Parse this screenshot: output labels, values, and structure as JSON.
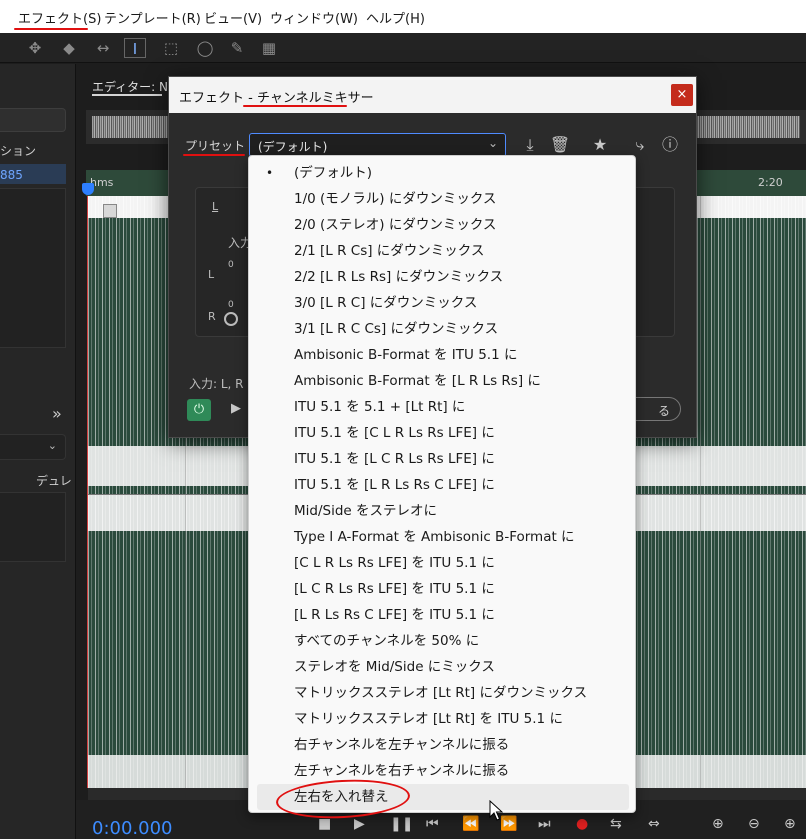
{
  "menubar": {
    "items": [
      "エフェクト(S)",
      "テンプレート(R)",
      "ビュー(V)",
      "ウィンドウ(W)",
      "ヘルプ(H)"
    ]
  },
  "left_panel": {
    "label_session": "ション",
    "value_selected": "885",
    "label_duration": "デュレ"
  },
  "editor": {
    "tab_label": "エディター: NSC",
    "ruler_ticks": [
      "hms",
      "2:20"
    ],
    "timecode": "0:00.000"
  },
  "dialog": {
    "title": "エフェクト - チャンネルミキサー",
    "close_label": "×",
    "preset_label": "プリセット :",
    "preset_value": "(デフォルト)",
    "inner_L": "L",
    "inner_input": "入力",
    "row_L": "L",
    "row_R": "R",
    "zero1": "0",
    "zero2": "0",
    "input_footer": "入力: L, R",
    "ok_partial": "る"
  },
  "dropdown": {
    "items": [
      "(デフォルト)",
      "1/0 (モノラル) にダウンミックス",
      "2/0 (ステレオ) にダウンミックス",
      "2/1 [L R Cs] にダウンミックス",
      "2/2 [L R Ls Rs] にダウンミックス",
      "3/0 [L R C] にダウンミックス",
      "3/1 [L R C Cs] にダウンミックス",
      "Ambisonic B-Format を ITU 5.1 に",
      "Ambisonic B-Format を [L R Ls Rs] に",
      "ITU 5.1 を 5.1 + [Lt Rt] に",
      "ITU 5.1 を [C L R Ls Rs LFE] に",
      "ITU 5.1 を [L C R Ls Rs LFE] に",
      "ITU 5.1 を [L R Ls Rs C LFE] に",
      "Mid/Side をステレオに",
      "Type I A-Format を Ambisonic B-Format に",
      "[C L R Ls Rs LFE] を ITU 5.1 に",
      "[L C R Ls Rs LFE] を ITU 5.1 に",
      "[L R Ls Rs C LFE] を ITU 5.1 に",
      "すべてのチャンネルを 50% に",
      "ステレオを Mid/Side にミックス",
      "マトリックスステレオ [Lt Rt] にダウンミックス",
      "マトリックスステレオ [Lt Rt] を ITU 5.1 に",
      "右チャンネルを左チャンネルに振る",
      "左チャンネルを右チャンネルに振る",
      "左右を入れ替え"
    ],
    "selected_bullet": "•"
  },
  "colors": {
    "accent_blue": "#3d8cff",
    "annotation_red": "#e01010",
    "waveform_green": "#2a4a3c",
    "power_green": "#2f8a58",
    "close_red": "#c42b1c"
  }
}
